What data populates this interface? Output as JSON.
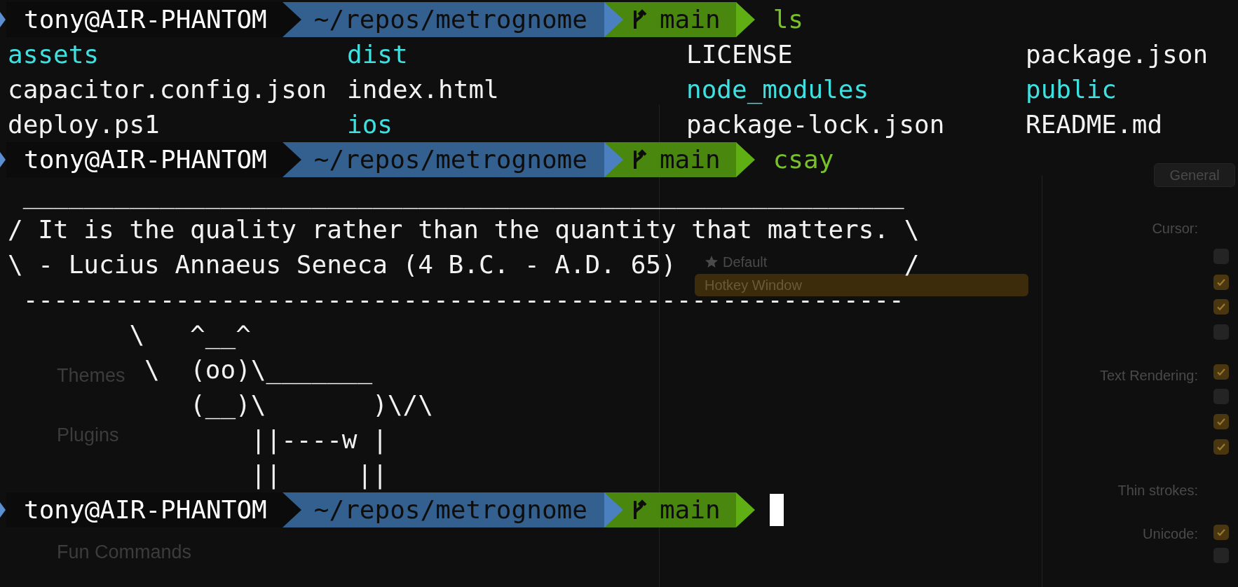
{
  "background": {
    "sidebar_items": [
      "Themes",
      "Plugins",
      "Fun Commands"
    ],
    "general_button": "General",
    "profiles": [
      {
        "name": "Default",
        "starred": true,
        "selected": false
      },
      {
        "name": "Hotkey Window",
        "starred": false,
        "selected": true
      }
    ],
    "settings_labels": [
      "Cursor:",
      "Text Rendering:",
      "Thin strokes:",
      "Unicode:"
    ],
    "checkboxes": [
      {
        "checked": false
      },
      {
        "checked": true
      },
      {
        "checked": true
      },
      {
        "checked": false
      },
      {
        "checked": true
      },
      {
        "checked": false
      },
      {
        "checked": true
      },
      {
        "checked": true
      },
      {
        "checked": true
      },
      {
        "checked": false
      }
    ]
  },
  "terminal": {
    "lines": [
      {
        "kind": "prompt",
        "user": "tony@AIR-PHANTOM",
        "path": "~/repos/metrognome",
        "branch": "main",
        "command": "ls",
        "cursor": false
      },
      {
        "kind": "listing",
        "entries": [
          {
            "name": "assets",
            "directory": true
          },
          {
            "name": "dist",
            "directory": true
          },
          {
            "name": "LICENSE",
            "directory": false
          },
          {
            "name": "package.json",
            "directory": false
          }
        ]
      },
      {
        "kind": "listing",
        "entries": [
          {
            "name": "capacitor.config.json",
            "directory": false
          },
          {
            "name": "index.html",
            "directory": false
          },
          {
            "name": "node_modules",
            "directory": true
          },
          {
            "name": "public",
            "directory": true
          }
        ]
      },
      {
        "kind": "listing",
        "entries": [
          {
            "name": "deploy.ps1",
            "directory": false
          },
          {
            "name": "ios",
            "directory": true
          },
          {
            "name": "package-lock.json",
            "directory": false
          },
          {
            "name": "README.md",
            "directory": false
          }
        ]
      },
      {
        "kind": "prompt",
        "user": "tony@AIR-PHANTOM",
        "path": "~/repos/metrognome",
        "branch": "main",
        "command": "csay",
        "cursor": false
      },
      {
        "kind": "output",
        "text": " __________________________________________________________"
      },
      {
        "kind": "output",
        "text": "/ It is the quality rather than the quantity that matters. \\"
      },
      {
        "kind": "output",
        "text": "\\ - Lucius Annaeus Seneca (4 B.C. - A.D. 65)               /"
      },
      {
        "kind": "output",
        "text": " ----------------------------------------------------------"
      },
      {
        "kind": "output",
        "text": "        \\   ^__^"
      },
      {
        "kind": "output",
        "text": "         \\  (oo)\\_______"
      },
      {
        "kind": "output",
        "text": "            (__)\\       )\\/\\"
      },
      {
        "kind": "output",
        "text": "                ||----w |"
      },
      {
        "kind": "output",
        "text": "                ||     ||"
      },
      {
        "kind": "prompt",
        "user": "tony@AIR-PHANTOM",
        "path": "~/repos/metrognome",
        "branch": "main",
        "cursor": true
      }
    ]
  }
}
